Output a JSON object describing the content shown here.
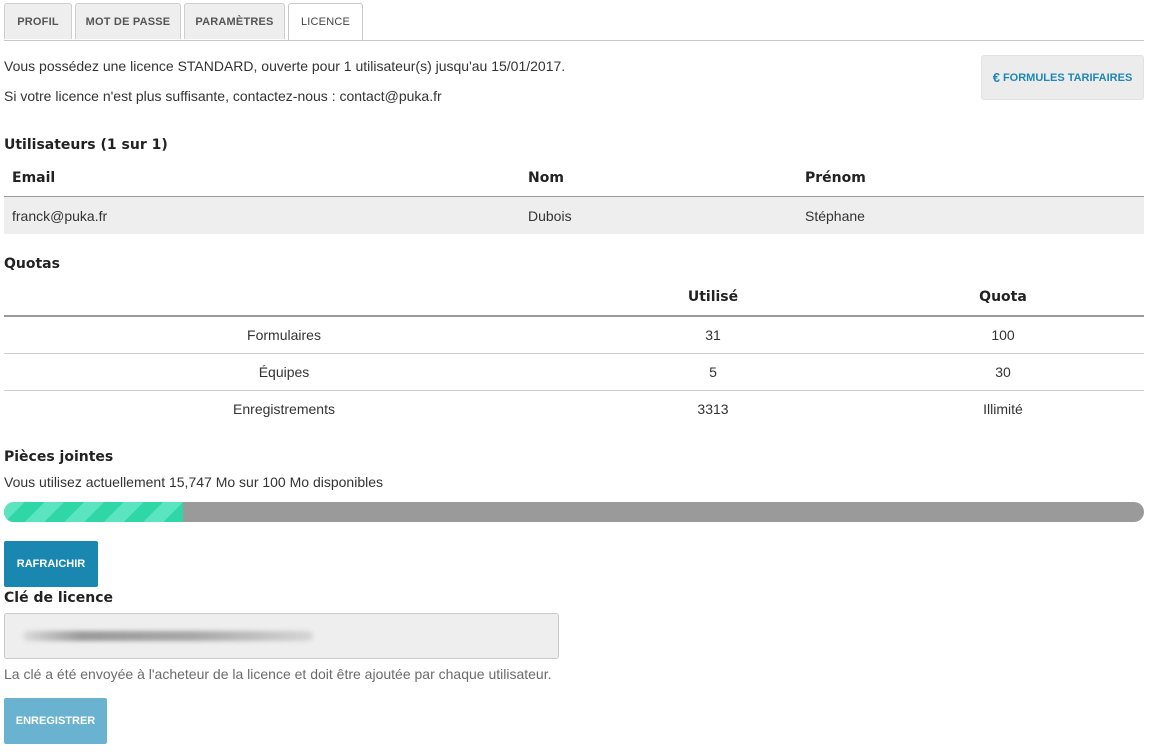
{
  "tabs": [
    {
      "label": "PROFIL",
      "active": false
    },
    {
      "label": "MOT DE PASSE",
      "active": false
    },
    {
      "label": "PARAMÈTRES",
      "active": false
    },
    {
      "label": "LICENCE",
      "active": true
    }
  ],
  "intro": {
    "line1": "Vous possédez une licence STANDARD, ouverte pour 1 utilisateur(s) jusqu'au 15/01/2017.",
    "line2": "Si votre licence n'est plus suffisante, contactez-nous : contact@puka.fr"
  },
  "pricing_button": {
    "icon": "€",
    "label": "FORMULES TARIFAIRES"
  },
  "users": {
    "title": "Utilisateurs (1 sur 1)",
    "columns": [
      "Email",
      "Nom",
      "Prénom"
    ],
    "rows": [
      [
        "franck@puka.fr",
        "Dubois",
        "Stéphane"
      ]
    ]
  },
  "quotas": {
    "title": "Quotas",
    "columns": [
      "",
      "Utilisé",
      "Quota"
    ],
    "rows": [
      [
        "Formulaires",
        "31",
        "100"
      ],
      [
        "Équipes",
        "5",
        "30"
      ],
      [
        "Enregistrements",
        "3313",
        "Illimité"
      ]
    ]
  },
  "attachments": {
    "title": "Pièces jointes",
    "usage_text": "Vous utilisez actuellement 15,747 Mo sur 100 Mo disponibles",
    "used_fraction": 0.157
  },
  "refresh_button": {
    "label": "RAFRAICHIR"
  },
  "license_key": {
    "title": "Clé de licence",
    "hint": "La clé a été envoyée à l'acheteur de la licence et doit être ajoutée par chaque utilisateur."
  },
  "save_button": {
    "label": "ENREGISTRER"
  },
  "colors": {
    "accent": "#1f87b3",
    "refresh_bg": "#1a87b1",
    "save_bg": "#6ab3d0",
    "progress_fill": "#2fd7a6",
    "progress_track": "#9a9a9a"
  }
}
